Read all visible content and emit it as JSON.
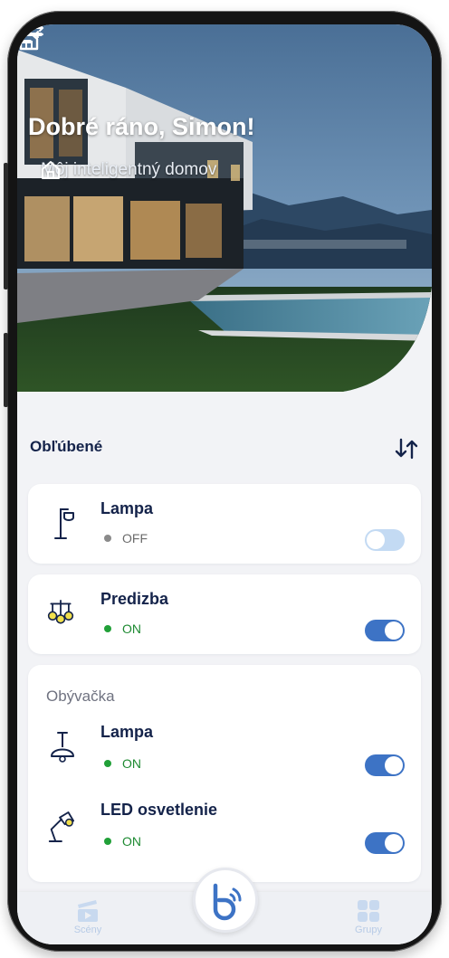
{
  "header": {
    "greeting": "Dobré ráno, Simon!",
    "home_name": "Môj inteligentný domov"
  },
  "favorites": {
    "title": "Obľúbené",
    "devices": [
      {
        "name": "Lampa",
        "status": "OFF",
        "icon": "floor-lamp-icon"
      },
      {
        "name": "Predizba",
        "status": "ON",
        "icon": "pendant-lights-icon"
      }
    ]
  },
  "room": {
    "name": "Obývačka",
    "devices": [
      {
        "name": "Lampa",
        "status": "ON",
        "icon": "ceiling-lamp-icon"
      },
      {
        "name": "LED osvetlenie",
        "status": "ON",
        "icon": "desk-lamp-icon"
      }
    ]
  },
  "bottom_nav": {
    "scenes_label": "Scény",
    "groups_label": "Grupy"
  },
  "colors": {
    "accent": "#3d73c5",
    "title": "#14234a",
    "on": "#21a038",
    "toggle_off": "#c3daf3"
  }
}
